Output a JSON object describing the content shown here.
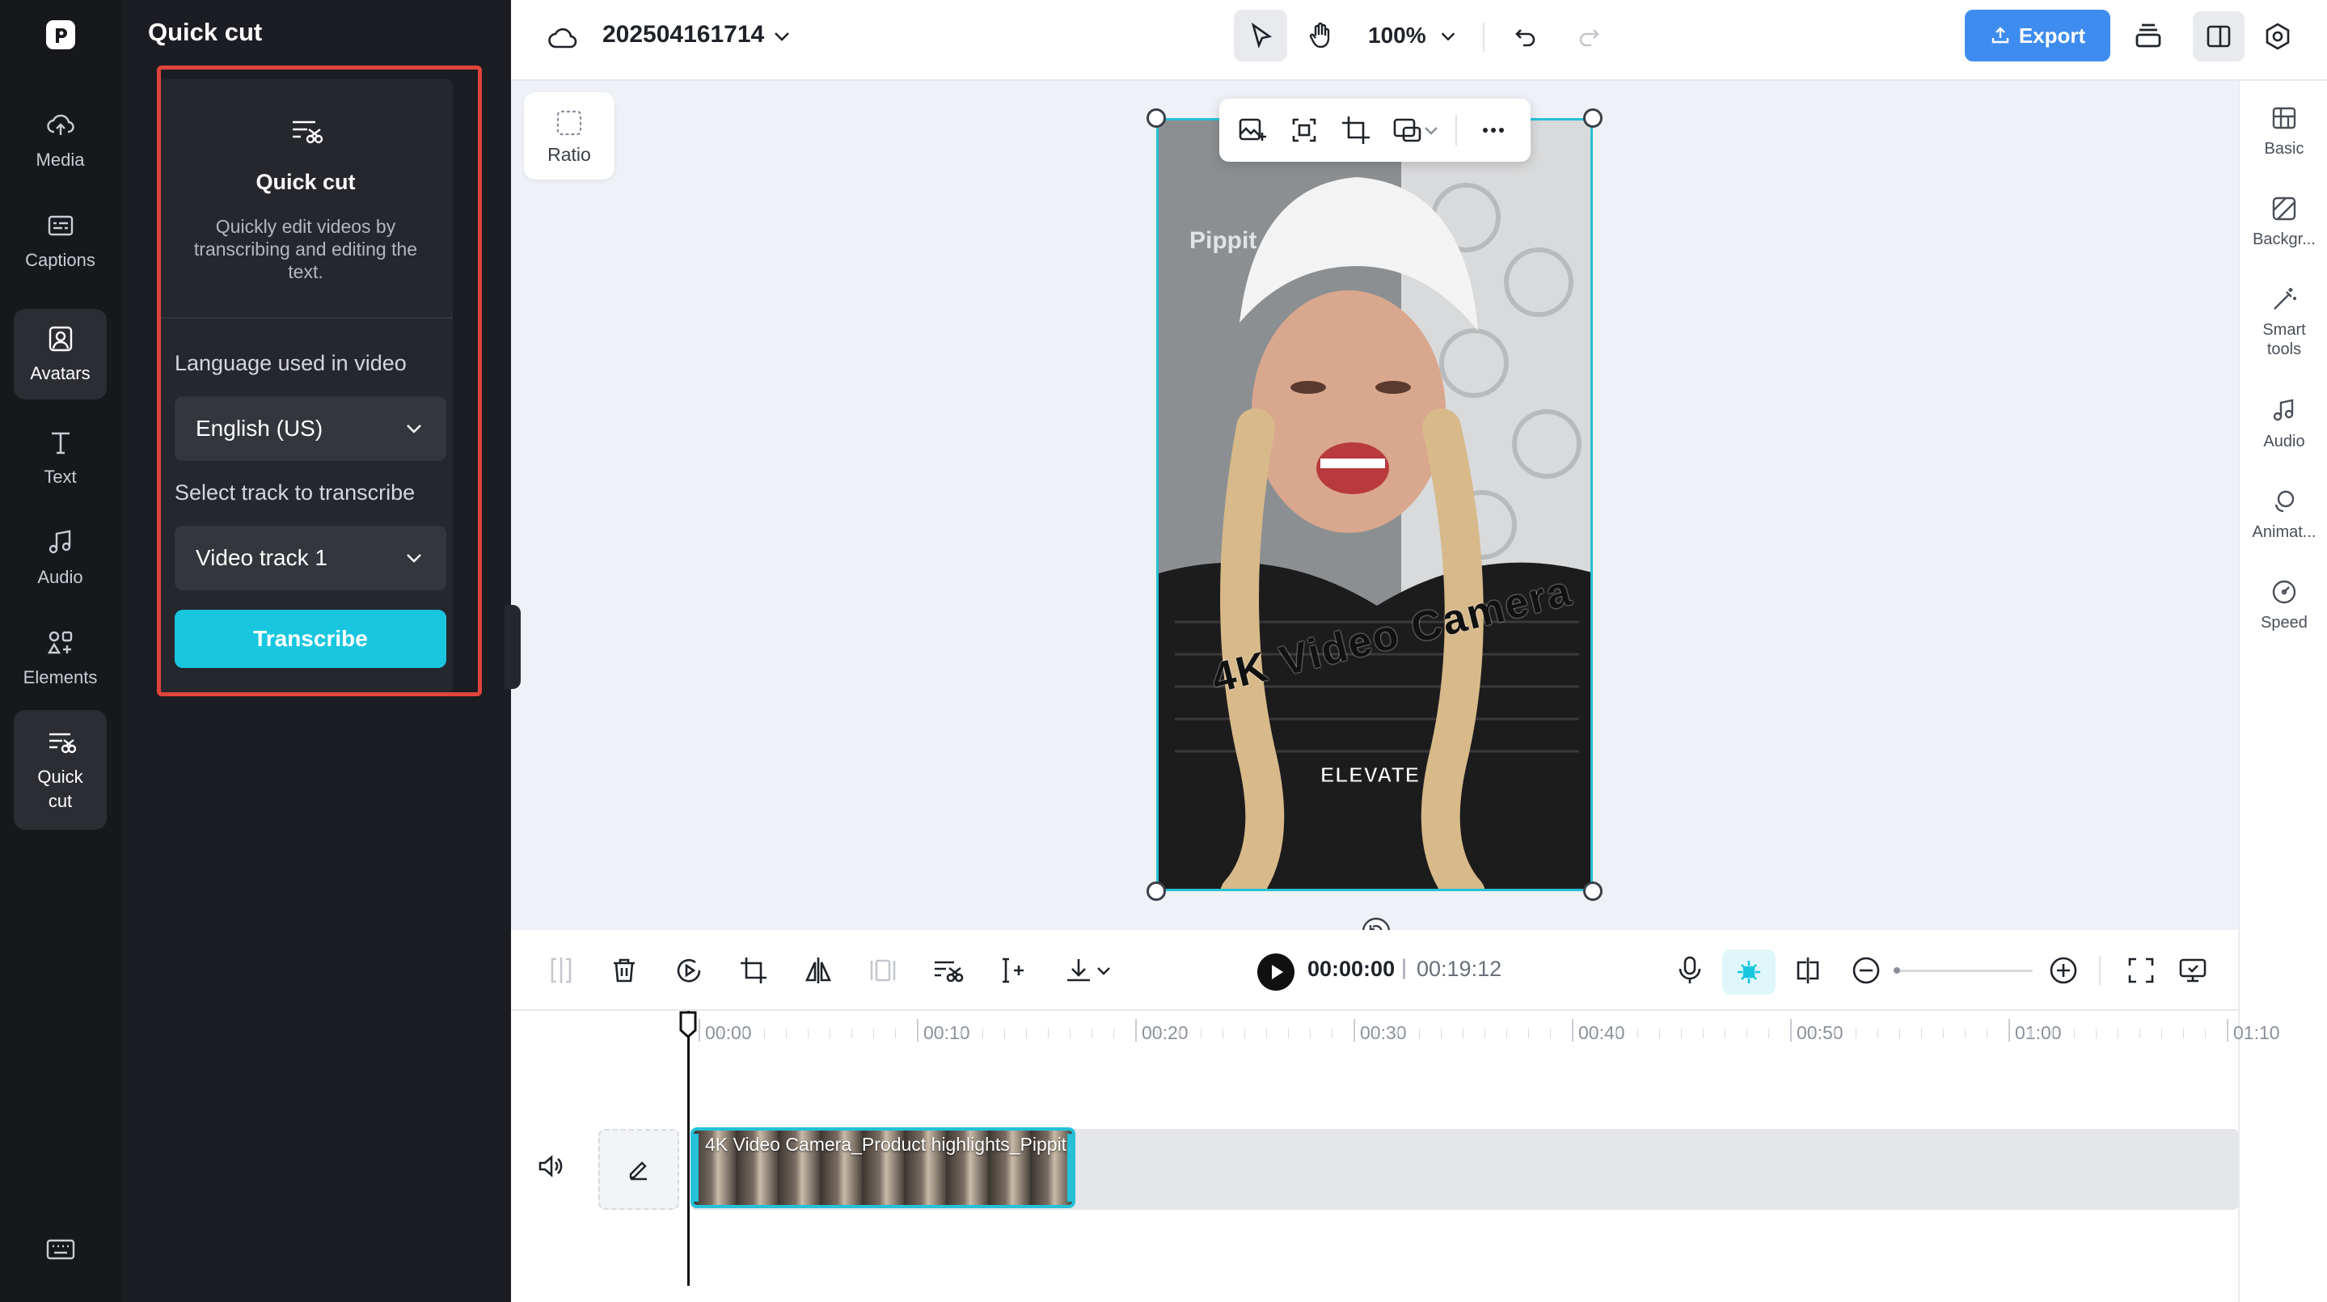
{
  "left_rail": {
    "items": [
      {
        "label": "Media",
        "icon": "cloud-upload-icon"
      },
      {
        "label": "Captions",
        "icon": "captions-icon"
      },
      {
        "label": "Avatars",
        "icon": "avatar-icon"
      },
      {
        "label": "Text",
        "icon": "text-icon"
      },
      {
        "label": "Audio",
        "icon": "music-note-icon"
      },
      {
        "label": "Elements",
        "icon": "elements-icon"
      },
      {
        "label": "Quick cut",
        "icon": "quick-cut-icon"
      }
    ]
  },
  "panel": {
    "title": "Quick cut",
    "card": {
      "title": "Quick cut",
      "description": "Quickly edit videos by transcribing and editing the text.",
      "language_label": "Language used in video",
      "language_value": "English (US)",
      "track_label": "Select track to transcribe",
      "track_value": "Video track 1",
      "transcribe_label": "Transcribe"
    }
  },
  "topbar": {
    "project_name": "202504161714",
    "zoom": "100%",
    "export_label": "Export"
  },
  "canvas": {
    "ratio_label": "Ratio",
    "watermark": "Pippit",
    "video_caption_main": "4K Video Camera",
    "video_caption_sub": "ELEVATE"
  },
  "right_rail": {
    "items": [
      {
        "label": "Basic"
      },
      {
        "label": "Backgr..."
      },
      {
        "label": "Smart tools"
      },
      {
        "label": "Audio"
      },
      {
        "label": "Animat..."
      },
      {
        "label": "Speed"
      }
    ]
  },
  "timeline": {
    "current_time": "00:00:00",
    "separator": "|",
    "total_time": "00:19:12",
    "ruler": [
      "00:00",
      "00:10",
      "00:20",
      "00:30",
      "00:40",
      "00:50",
      "01:00",
      "01:10"
    ],
    "clip_label": "4K Video Camera_Product highlights_Pippit"
  },
  "colors": {
    "accent": "#19c6df",
    "export": "#3f8cf0",
    "highlight": "#e0443c"
  }
}
